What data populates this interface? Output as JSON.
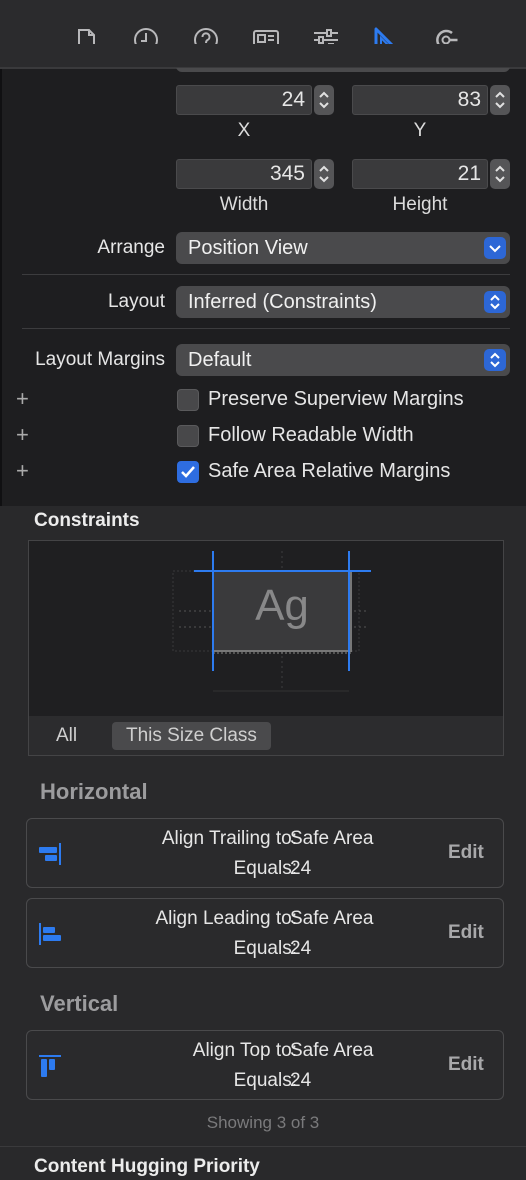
{
  "toolbar": {
    "icons": [
      "file-icon",
      "history-icon",
      "help-icon",
      "identity-icon",
      "attributes-icon",
      "size-ruler-icon",
      "connections-icon"
    ],
    "active": "size-ruler-icon",
    "accent": "#2d7bf0"
  },
  "frame": {
    "x_value": "24",
    "y_value": "83",
    "x_label": "X",
    "y_label": "Y",
    "width_value": "345",
    "height_value": "21",
    "width_label": "Width",
    "height_label": "Height"
  },
  "arrange": {
    "label": "Arrange",
    "value": "Position View"
  },
  "layout": {
    "label": "Layout",
    "value": "Inferred (Constraints)"
  },
  "margins": {
    "label": "Layout Margins",
    "value": "Default",
    "options": [
      {
        "label": "Preserve Superview Margins",
        "checked": false
      },
      {
        "label": "Follow Readable Width",
        "checked": false
      },
      {
        "label": "Safe Area Relative Margins",
        "checked": true
      }
    ],
    "plus": "+"
  },
  "constraints": {
    "title": "Constraints",
    "preview_text": "Ag",
    "tabs": [
      "All",
      "This Size Class"
    ],
    "horizontal_title": "Horizontal",
    "vertical_title": "Vertical",
    "horizontal": [
      {
        "line1_key": "Align Trailing to:",
        "line1_val": "Safe Area",
        "line2_key": "Equals:",
        "line2_val": "24",
        "edit": "Edit",
        "icon": "align-trailing-icon"
      },
      {
        "line1_key": "Align Leading to:",
        "line1_val": "Safe Area",
        "line2_key": "Equals:",
        "line2_val": "24",
        "edit": "Edit",
        "icon": "align-leading-icon"
      }
    ],
    "vertical": [
      {
        "line1_key": "Align Top to:",
        "line1_val": "Safe Area",
        "line2_key": "Equals:",
        "line2_val": "24",
        "edit": "Edit",
        "icon": "align-top-icon"
      }
    ],
    "showing": "Showing 3 of 3"
  },
  "hugging": {
    "title": "Content Hugging Priority"
  }
}
